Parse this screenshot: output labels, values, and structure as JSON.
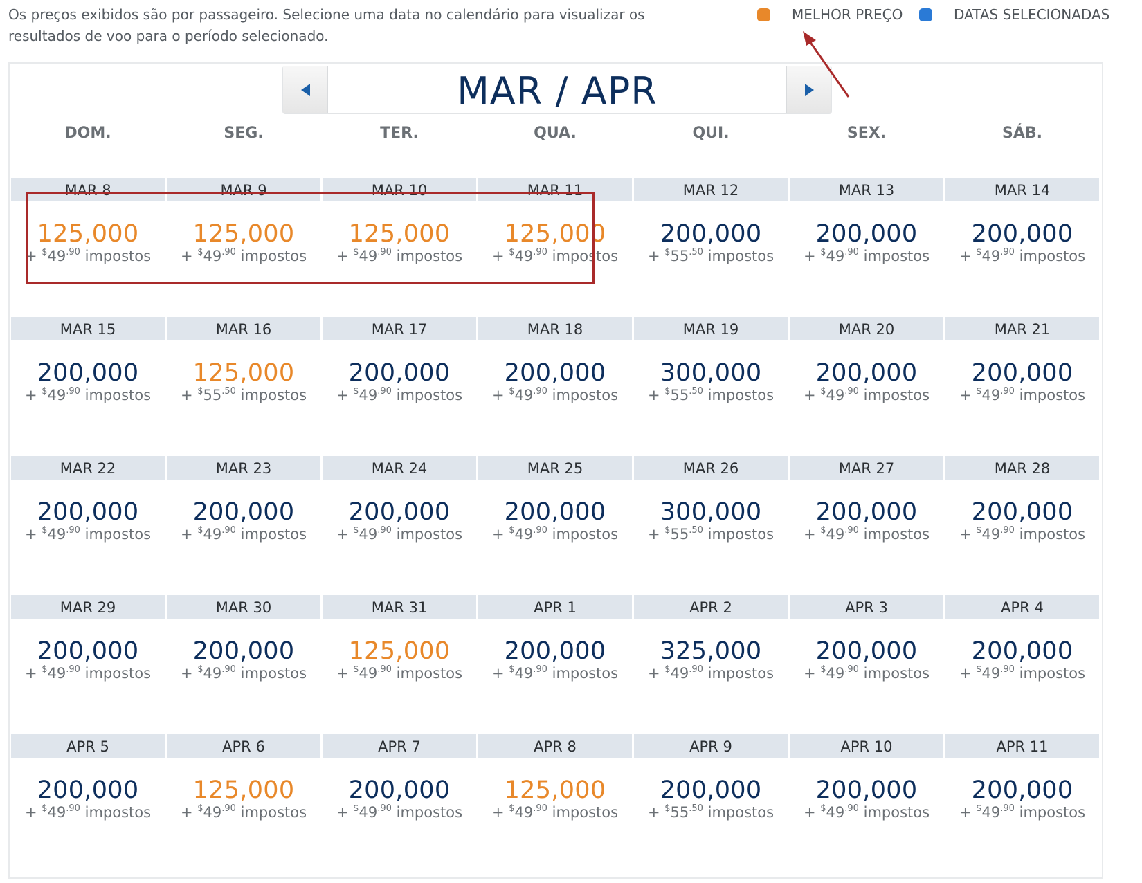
{
  "intro_text": "Os preços exibidos são por passageiro. Selecione uma data no calendário para visualizar os resultados de voo para o período selecionado.",
  "legend": {
    "best_label": "MELHOR PREÇO",
    "best_color": "#e8882a",
    "selected_label": "DATAS SELECIONADAS",
    "selected_color": "#2a7ad6"
  },
  "annotation_color": "#a92a2a",
  "nav": {
    "month": "MAR / APR",
    "prev_icon": "triangle-left-icon",
    "next_icon": "triangle-right-icon"
  },
  "weekdays": [
    "DOM.",
    "SEG.",
    "TER.",
    "QUA.",
    "QUI.",
    "SEX.",
    "SÁB."
  ],
  "tax_suffix": "impostos",
  "weeks": [
    [
      {
        "date": "MAR 8",
        "miles": "125,000",
        "tax_d": "49",
        "tax_c": "90",
        "best": true
      },
      {
        "date": "MAR 9",
        "miles": "125,000",
        "tax_d": "49",
        "tax_c": "90",
        "best": true
      },
      {
        "date": "MAR 10",
        "miles": "125,000",
        "tax_d": "49",
        "tax_c": "90",
        "best": true
      },
      {
        "date": "MAR 11",
        "miles": "125,000",
        "tax_d": "49",
        "tax_c": "90",
        "best": true
      },
      {
        "date": "MAR 12",
        "miles": "200,000",
        "tax_d": "55",
        "tax_c": "50",
        "best": false
      },
      {
        "date": "MAR 13",
        "miles": "200,000",
        "tax_d": "49",
        "tax_c": "90",
        "best": false
      },
      {
        "date": "MAR 14",
        "miles": "200,000",
        "tax_d": "49",
        "tax_c": "90",
        "best": false
      }
    ],
    [
      {
        "date": "MAR 15",
        "miles": "200,000",
        "tax_d": "49",
        "tax_c": "90",
        "best": false
      },
      {
        "date": "MAR 16",
        "miles": "125,000",
        "tax_d": "55",
        "tax_c": "50",
        "best": true
      },
      {
        "date": "MAR 17",
        "miles": "200,000",
        "tax_d": "49",
        "tax_c": "90",
        "best": false
      },
      {
        "date": "MAR 18",
        "miles": "200,000",
        "tax_d": "49",
        "tax_c": "90",
        "best": false
      },
      {
        "date": "MAR 19",
        "miles": "300,000",
        "tax_d": "55",
        "tax_c": "50",
        "best": false
      },
      {
        "date": "MAR 20",
        "miles": "200,000",
        "tax_d": "49",
        "tax_c": "90",
        "best": false
      },
      {
        "date": "MAR 21",
        "miles": "200,000",
        "tax_d": "49",
        "tax_c": "90",
        "best": false
      }
    ],
    [
      {
        "date": "MAR 22",
        "miles": "200,000",
        "tax_d": "49",
        "tax_c": "90",
        "best": false
      },
      {
        "date": "MAR 23",
        "miles": "200,000",
        "tax_d": "49",
        "tax_c": "90",
        "best": false
      },
      {
        "date": "MAR 24",
        "miles": "200,000",
        "tax_d": "49",
        "tax_c": "90",
        "best": false
      },
      {
        "date": "MAR 25",
        "miles": "200,000",
        "tax_d": "49",
        "tax_c": "90",
        "best": false
      },
      {
        "date": "MAR 26",
        "miles": "300,000",
        "tax_d": "55",
        "tax_c": "50",
        "best": false
      },
      {
        "date": "MAR 27",
        "miles": "200,000",
        "tax_d": "49",
        "tax_c": "90",
        "best": false
      },
      {
        "date": "MAR 28",
        "miles": "200,000",
        "tax_d": "49",
        "tax_c": "90",
        "best": false
      }
    ],
    [
      {
        "date": "MAR 29",
        "miles": "200,000",
        "tax_d": "49",
        "tax_c": "90",
        "best": false
      },
      {
        "date": "MAR 30",
        "miles": "200,000",
        "tax_d": "49",
        "tax_c": "90",
        "best": false
      },
      {
        "date": "MAR 31",
        "miles": "125,000",
        "tax_d": "49",
        "tax_c": "90",
        "best": true
      },
      {
        "date": "APR 1",
        "miles": "200,000",
        "tax_d": "49",
        "tax_c": "90",
        "best": false
      },
      {
        "date": "APR 2",
        "miles": "325,000",
        "tax_d": "49",
        "tax_c": "90",
        "best": false
      },
      {
        "date": "APR 3",
        "miles": "200,000",
        "tax_d": "49",
        "tax_c": "90",
        "best": false
      },
      {
        "date": "APR 4",
        "miles": "200,000",
        "tax_d": "49",
        "tax_c": "90",
        "best": false
      }
    ],
    [
      {
        "date": "APR 5",
        "miles": "200,000",
        "tax_d": "49",
        "tax_c": "90",
        "best": false
      },
      {
        "date": "APR 6",
        "miles": "125,000",
        "tax_d": "49",
        "tax_c": "90",
        "best": true
      },
      {
        "date": "APR 7",
        "miles": "200,000",
        "tax_d": "49",
        "tax_c": "90",
        "best": false
      },
      {
        "date": "APR 8",
        "miles": "125,000",
        "tax_d": "49",
        "tax_c": "90",
        "best": true
      },
      {
        "date": "APR 9",
        "miles": "200,000",
        "tax_d": "55",
        "tax_c": "50",
        "best": false
      },
      {
        "date": "APR 10",
        "miles": "200,000",
        "tax_d": "49",
        "tax_c": "90",
        "best": false
      },
      {
        "date": "APR 11",
        "miles": "200,000",
        "tax_d": "49",
        "tax_c": "90",
        "best": false
      }
    ]
  ]
}
